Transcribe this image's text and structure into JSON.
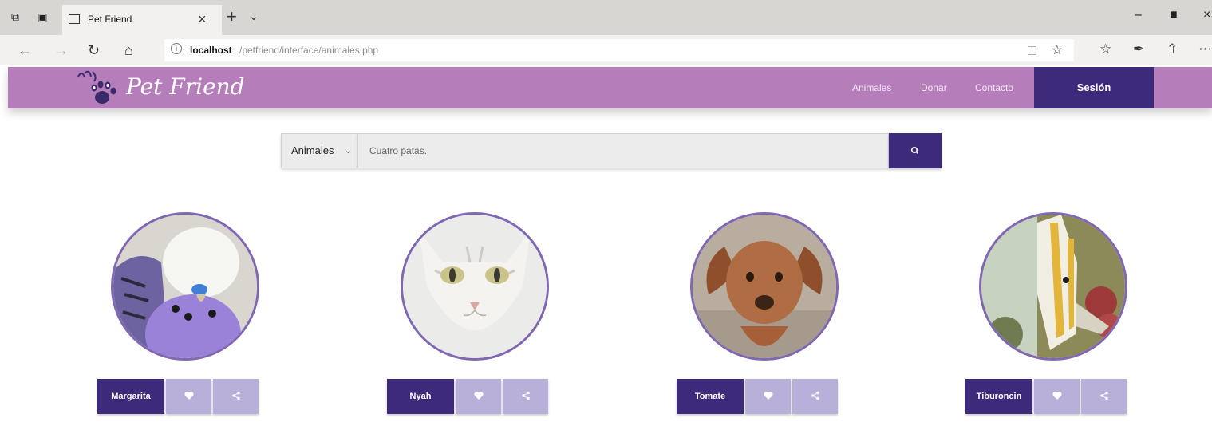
{
  "browser": {
    "tab_title": "Pet Friend",
    "url_host": "localhost",
    "url_path": "/petfriend/interface/animales.php"
  },
  "header": {
    "logo_text": "Pet Friend",
    "nav": [
      "Animales",
      "Donar",
      "Contacto"
    ],
    "session_label": "Sesión"
  },
  "search": {
    "category": "Animales",
    "placeholder": "Cuatro patas."
  },
  "animals": [
    {
      "name": "Margarita",
      "photo": "budgie"
    },
    {
      "name": "Nyah",
      "photo": "cat"
    },
    {
      "name": "Tomate",
      "photo": "dog"
    },
    {
      "name": "Tiburoncin",
      "photo": "fish"
    }
  ],
  "colors": {
    "header": "#b67dbb",
    "primary": "#3e2a7a",
    "secondary": "#b9b0da",
    "ring": "#8067b2"
  }
}
